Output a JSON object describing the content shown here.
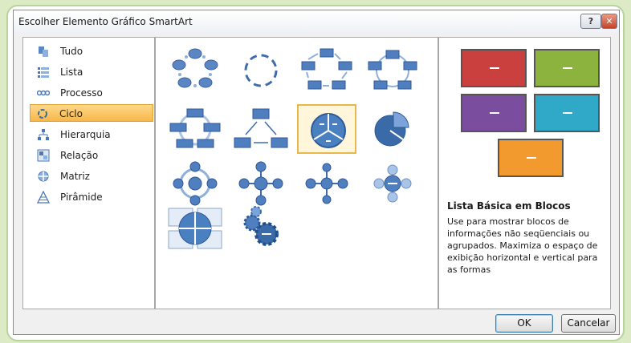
{
  "dialog": {
    "title": "Escolher Elemento Gráfico SmartArt",
    "help_label": "?",
    "close_label": "✕"
  },
  "categories": [
    {
      "label": "Tudo",
      "icon": "all-icon"
    },
    {
      "label": "Lista",
      "icon": "list-icon"
    },
    {
      "label": "Processo",
      "icon": "process-icon"
    },
    {
      "label": "Ciclo",
      "icon": "cycle-icon",
      "selected": true
    },
    {
      "label": "Hierarquia",
      "icon": "hierarchy-icon"
    },
    {
      "label": "Relação",
      "icon": "relationship-icon"
    },
    {
      "label": "Matriz",
      "icon": "matrix-icon"
    },
    {
      "label": "Pirâmide",
      "icon": "pyramid-icon"
    }
  ],
  "gallery": {
    "selected_index": 6,
    "items": [
      "basic-cycle",
      "segmented-cycle",
      "block-cycle",
      "nondirectional-cycle",
      "continuous-cycle",
      "text-cycle",
      "basic-pie",
      "cycle-matrix",
      "radial-cycle",
      "diverging-radial",
      "basic-radial",
      "multidirectional-cycle",
      "cycle-matrix-2",
      "gear"
    ]
  },
  "preview": {
    "title": "Lista Básica em Blocos",
    "description": "Use para mostrar blocos de informações não seqüenciais ou agrupados. Maximiza o espaço de exibição horizontal e vertical para as formas",
    "block_colors": [
      "#c9403e",
      "#8bb33e",
      "#7a4d9e",
      "#2fa9c7",
      "#f39a2e"
    ]
  },
  "buttons": {
    "ok_label": "OK",
    "cancel_label": "Cancelar"
  }
}
